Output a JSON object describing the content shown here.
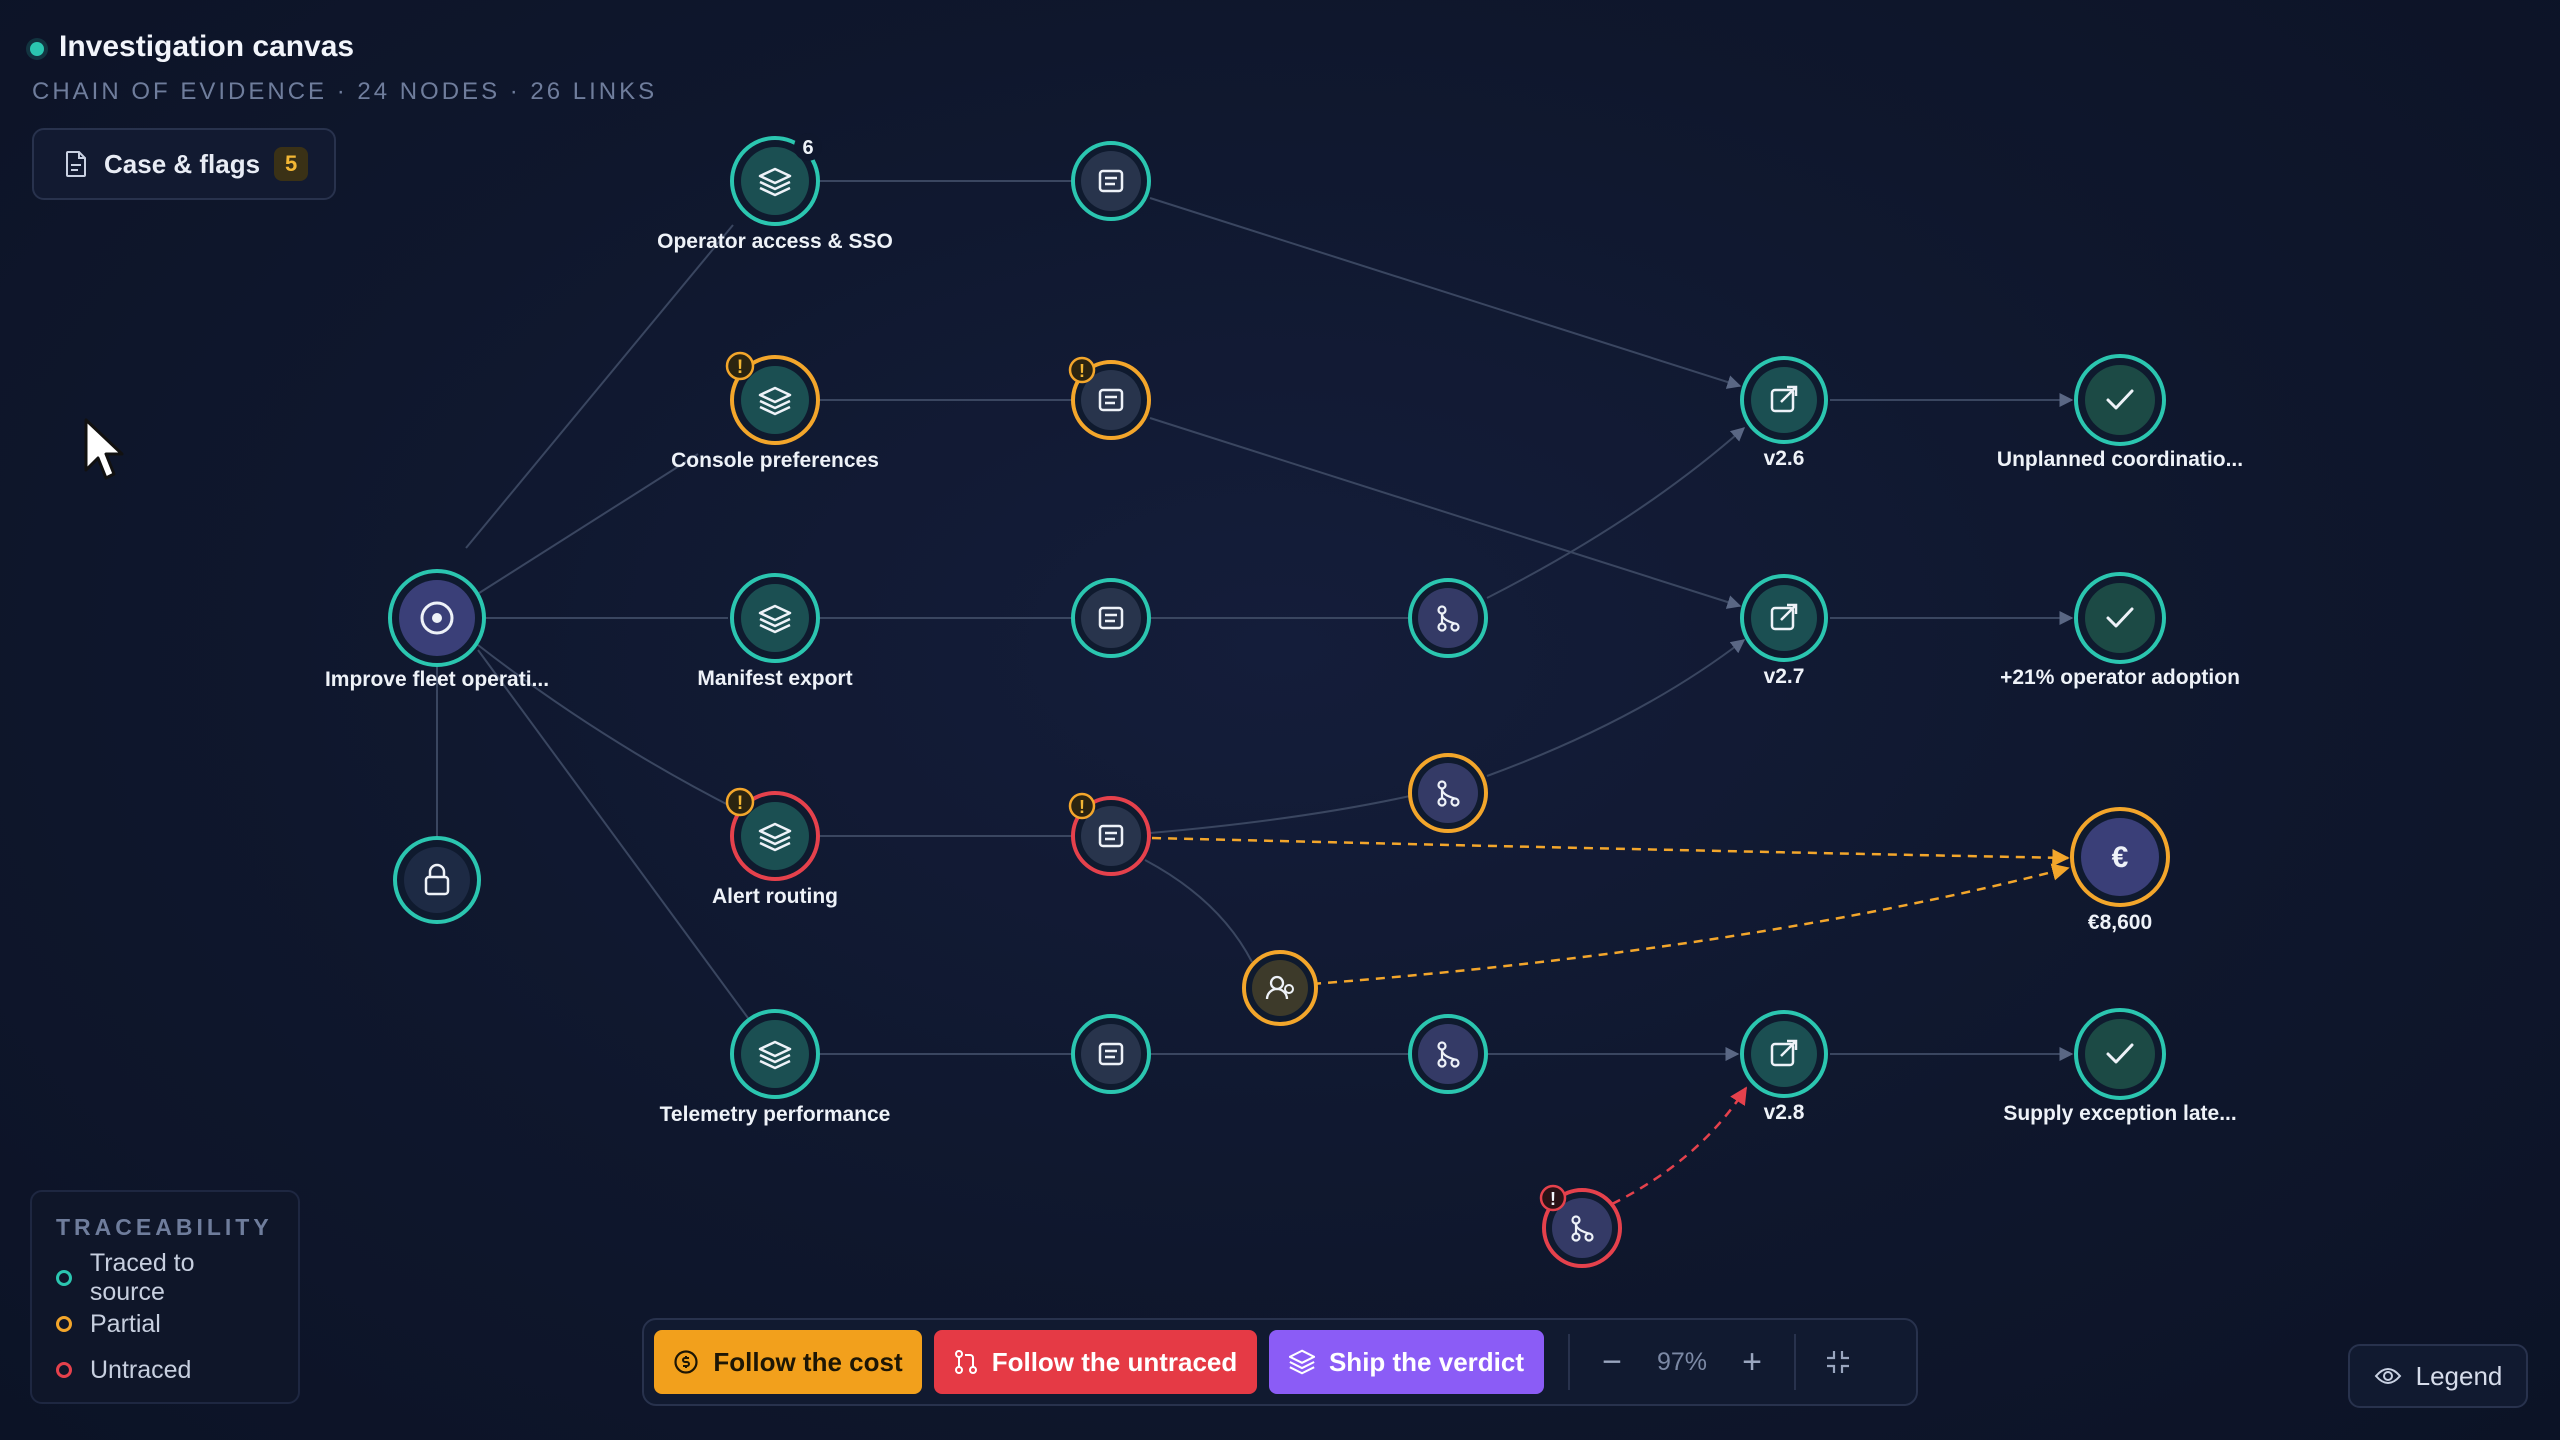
{
  "header": {
    "title": "Investigation canvas",
    "subtitle": "CHAIN OF EVIDENCE · 24 NODES · 26 LINKS"
  },
  "case_flags": {
    "label": "Case & flags",
    "count": "5"
  },
  "colors": {
    "traced": "#2bc6b0",
    "partial": "#f3a62b",
    "untraced": "#e5414c",
    "accent_purple": "#8b5cf6"
  },
  "nodes": {
    "operator_access": {
      "label": "Operator access & SSO",
      "badge": "6"
    },
    "console_prefs": {
      "label": "Console preferences"
    },
    "manifest_export": {
      "label": "Manifest export"
    },
    "alert_routing": {
      "label": "Alert routing"
    },
    "telemetry_perf": {
      "label": "Telemetry performance"
    },
    "improve_fleet": {
      "label": "Improve fleet operati..."
    },
    "v26": {
      "label": "v2.6"
    },
    "v27": {
      "label": "v2.7"
    },
    "v28": {
      "label": "v2.8"
    },
    "unplanned": {
      "label": "Unplanned coordinatio..."
    },
    "adoption": {
      "label": "+21% operator adoption"
    },
    "cost": {
      "label": "€8,600",
      "symbol": "€"
    },
    "supply": {
      "label": "Supply exception late..."
    },
    "warning_mark": "!"
  },
  "traceability": {
    "title": "TRACEABILITY",
    "items": [
      {
        "label": "Traced to source",
        "color": "#2bc6b0"
      },
      {
        "label": "Partial",
        "color": "#f3a62b"
      },
      {
        "label": "Untraced",
        "color": "#e5414c"
      }
    ]
  },
  "toolbar": {
    "follow_cost": "Follow the cost",
    "follow_untraced": "Follow the untraced",
    "ship_verdict": "Ship the verdict",
    "zoom_out": "−",
    "zoom_level": "97%",
    "zoom_in": "+"
  },
  "legend_button": {
    "label": "Legend"
  }
}
